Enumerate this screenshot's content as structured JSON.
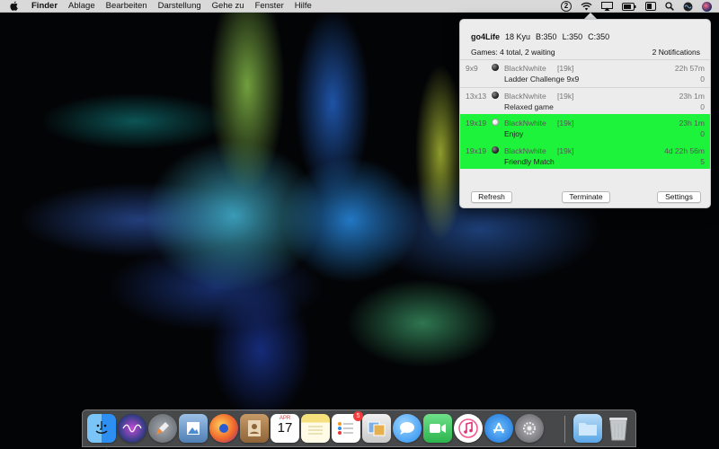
{
  "menubar": {
    "app_name": "Finder",
    "items": [
      "Ablage",
      "Bearbeiten",
      "Darstellung",
      "Gehe zu",
      "Fenster",
      "Hilfe"
    ],
    "status_icons": [
      "go4life-status-icon",
      "wifi-icon",
      "airplay-icon",
      "battery-icon",
      "control-strip-icon",
      "search-icon",
      "siri-icon",
      "user-avatar-icon"
    ],
    "go4life_status_label": "2"
  },
  "popover": {
    "user": "go4Life",
    "rank": "18 Kyu",
    "b": "B:350",
    "l": "L:350",
    "c": "C:350",
    "summary": "Games: 4 total, 2 waiting",
    "notifications": "2 Notifications",
    "games": [
      {
        "size": "9x9",
        "stone": "black",
        "opponent": "BlackNwhite",
        "rank": "[19k]",
        "time": "22h 57m",
        "name": "Ladder Challenge 9x9",
        "moves": "0",
        "highlight": false
      },
      {
        "size": "13x13",
        "stone": "black",
        "opponent": "BlackNwhite",
        "rank": "[19k]",
        "time": "23h 1m",
        "name": "Relaxed game",
        "moves": "0",
        "highlight": false
      },
      {
        "size": "19x19",
        "stone": "white",
        "opponent": "BlackNwhite",
        "rank": "[19k]",
        "time": "23h 1m",
        "name": "Enjoy",
        "moves": "0",
        "highlight": true
      },
      {
        "size": "19x19",
        "stone": "black",
        "opponent": "BlackNwhite",
        "rank": "[19k]",
        "time": "4d 22h 56m",
        "name": "Friendly Match",
        "moves": "5",
        "highlight": true
      }
    ],
    "buttons": {
      "refresh": "Refresh",
      "terminate": "Terminate",
      "settings": "Settings"
    },
    "highlight_color": "#1df33a"
  },
  "dock": {
    "apps": [
      {
        "name": "finder-icon",
        "glyph": "☺",
        "color": "#2d8ff2"
      },
      {
        "name": "siri-icon",
        "glyph": "◉",
        "color": "#3a3f8a"
      },
      {
        "name": "launchpad-icon",
        "glyph": "➚",
        "color": "#7b7f86"
      },
      {
        "name": "preview-icon",
        "glyph": "▣",
        "color": "#6c8fb8"
      },
      {
        "name": "firefox-icon",
        "glyph": "◎",
        "color": "#e8632b"
      },
      {
        "name": "contacts-icon",
        "glyph": "☷",
        "color": "#a97b4f"
      },
      {
        "name": "calendar-icon",
        "glyph": "17",
        "color": "#ffffff"
      },
      {
        "name": "notes-icon",
        "glyph": "≡",
        "color": "#f3df7a"
      },
      {
        "name": "reminders-icon",
        "glyph": "☰",
        "color": "#ffffff",
        "badge": "5"
      },
      {
        "name": "photos-slideshow-icon",
        "glyph": "▤",
        "color": "#e7e7e7"
      },
      {
        "name": "messages-icon",
        "glyph": "…",
        "color": "#3aa0f5"
      },
      {
        "name": "facetime-icon",
        "glyph": "▶",
        "color": "#38c759"
      },
      {
        "name": "itunes-icon",
        "glyph": "♫",
        "color": "#f2f2f2"
      },
      {
        "name": "app-store-icon",
        "glyph": "A",
        "color": "#2a8ef0"
      },
      {
        "name": "system-preferences-icon",
        "glyph": "⚙",
        "color": "#8e8e93"
      },
      {
        "name": "downloads-folder-icon",
        "glyph": "▭",
        "color": "#8fc4ee"
      },
      {
        "name": "trash-icon",
        "glyph": "▯",
        "color": "#cfd3d6"
      }
    ],
    "calendar_month": "APR",
    "calendar_day": "17"
  }
}
